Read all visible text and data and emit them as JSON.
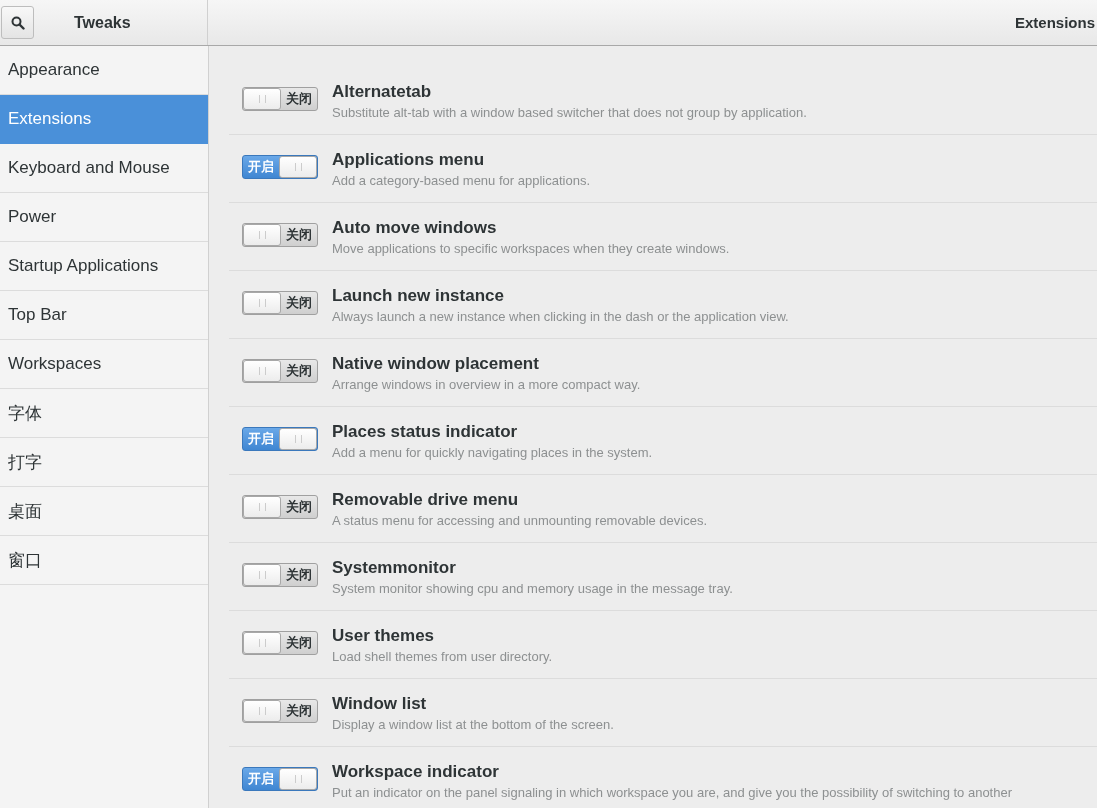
{
  "header": {
    "title": "Tweaks",
    "page_title": "Extensions"
  },
  "sidebar": {
    "items": [
      {
        "label": "Appearance",
        "selected": false
      },
      {
        "label": "Extensions",
        "selected": true
      },
      {
        "label": "Keyboard and Mouse",
        "selected": false
      },
      {
        "label": "Power",
        "selected": false
      },
      {
        "label": "Startup Applications",
        "selected": false
      },
      {
        "label": "Top Bar",
        "selected": false
      },
      {
        "label": "Workspaces",
        "selected": false
      },
      {
        "label": "字体",
        "selected": false
      },
      {
        "label": "打字",
        "selected": false
      },
      {
        "label": "桌面",
        "selected": false
      },
      {
        "label": "窗口",
        "selected": false
      }
    ]
  },
  "extensions": [
    {
      "name": "Alternatetab",
      "description": "Substitute alt-tab with a window based switcher that does not group by application.",
      "on": false,
      "switch_label": "关闭"
    },
    {
      "name": "Applications menu",
      "description": "Add a category-based menu for applications.",
      "on": true,
      "switch_label": "开启"
    },
    {
      "name": "Auto move windows",
      "description": "Move applications to specific workspaces when they create windows.",
      "on": false,
      "switch_label": "关闭"
    },
    {
      "name": "Launch new instance",
      "description": "Always launch a new instance when clicking in the dash or the application view.",
      "on": false,
      "switch_label": "关闭"
    },
    {
      "name": "Native window placement",
      "description": "Arrange windows in overview in a more compact way.",
      "on": false,
      "switch_label": "关闭"
    },
    {
      "name": "Places status indicator",
      "description": "Add a menu for quickly navigating places in the system.",
      "on": true,
      "switch_label": "开启"
    },
    {
      "name": "Removable drive menu",
      "description": "A status menu for accessing and unmounting removable devices.",
      "on": false,
      "switch_label": "关闭"
    },
    {
      "name": "Systemmonitor",
      "description": "System monitor showing cpu and memory usage in the message tray.",
      "on": false,
      "switch_label": "关闭"
    },
    {
      "name": "User themes",
      "description": "Load shell themes from user directory.",
      "on": false,
      "switch_label": "关闭"
    },
    {
      "name": "Window list",
      "description": "Display a window list at the bottom of the screen.",
      "on": false,
      "switch_label": "关闭"
    },
    {
      "name": "Workspace indicator",
      "description": "Put an indicator on the panel signaling in which workspace you are, and give you the possibility of switching to another",
      "on": true,
      "switch_label": "开启"
    }
  ]
}
